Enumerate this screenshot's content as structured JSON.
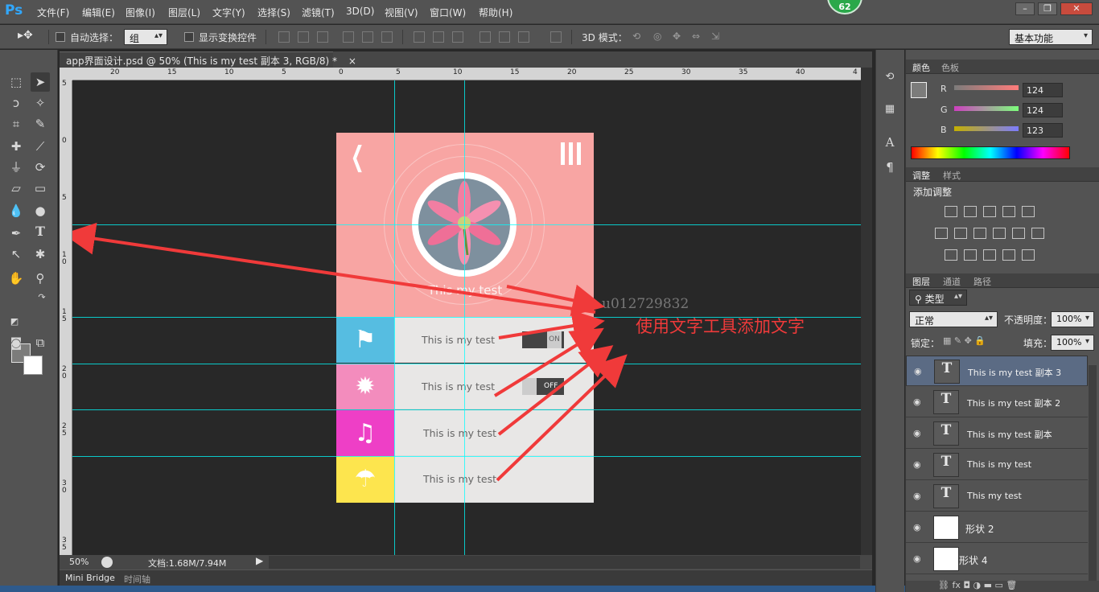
{
  "app": {
    "logo": "Ps",
    "badge": "62"
  },
  "menu": [
    "文件(F)",
    "编辑(E)",
    "图像(I)",
    "图层(L)",
    "文字(Y)",
    "选择(S)",
    "滤镜(T)",
    "3D(D)",
    "视图(V)",
    "窗口(W)",
    "帮助(H)"
  ],
  "options": {
    "auto_select_label": "自动选择：",
    "auto_select_value": "组",
    "show_transform_label": "显示变换控件",
    "mode3d_label": "3D 模式：",
    "workspace": "基本功能"
  },
  "document": {
    "tab_title": "app界面设计.psd @ 50% (This is my test 副本 3, RGB/8) *",
    "close": "×"
  },
  "ruler": {
    "h_ticks": [
      "20",
      "15",
      "10",
      "5",
      "0",
      "5",
      "10",
      "15",
      "20",
      "25",
      "30",
      "35",
      "40",
      "4"
    ],
    "v_ticks": [
      "5",
      "0",
      "5",
      "1\n0",
      "1\n5",
      "2\n0",
      "2\n5",
      "3\n0",
      "3\n5"
    ]
  },
  "mockup": {
    "back_icon": "chevron-left-icon",
    "menu_icon": "hamburger-icon",
    "header_title": "This my test",
    "header_color": "#f8a5a3",
    "rows": [
      {
        "icon": "flag-icon",
        "color": "#56bde1",
        "text": "This is my test",
        "toggle": "ON"
      },
      {
        "icon": "sun-icon",
        "color": "#f38cbd",
        "text": "This is my test",
        "toggle": "OFF"
      },
      {
        "icon": "music-icon",
        "color": "#ee3fc6",
        "text": "This is my test",
        "toggle": ""
      },
      {
        "icon": "umbrella-icon",
        "color": "#fde54e",
        "text": "This is my test",
        "toggle": ""
      }
    ]
  },
  "annotations": {
    "watermark": "u012729832",
    "note": "使用文字工具添加文字",
    "arrow_color": "#f03a3a"
  },
  "status": {
    "zoom": "50%",
    "doc_size": "文档:1.68M/7.94M"
  },
  "bottom_tabs": [
    "Mini Bridge",
    "时间轴"
  ],
  "color_panel": {
    "tabs": [
      "颜色",
      "色板"
    ],
    "channels": [
      {
        "label": "R",
        "value": "124"
      },
      {
        "label": "G",
        "value": "124"
      },
      {
        "label": "B",
        "value": "123"
      }
    ],
    "foreground": "#7c7c7b"
  },
  "adjust_panel": {
    "tabs": [
      "调整",
      "样式"
    ],
    "title": "添加调整"
  },
  "layers_panel": {
    "tabs": [
      "图层",
      "通道",
      "路径"
    ],
    "filter": "类型",
    "blend_mode": "正常",
    "opacity_label": "不透明度：",
    "opacity": "100%",
    "lock_label": "锁定：",
    "fill_label": "填充：",
    "fill": "100%",
    "layers": [
      {
        "name": "This is my test 副本 3",
        "kind": "text",
        "selected": true
      },
      {
        "name": "This is my test 副本 2",
        "kind": "text",
        "selected": false
      },
      {
        "name": "This is my test 副本",
        "kind": "text",
        "selected": false
      },
      {
        "name": "This is my test",
        "kind": "text",
        "selected": false
      },
      {
        "name": "This my test",
        "kind": "text",
        "selected": false
      },
      {
        "name": "形状 2",
        "kind": "shape",
        "selected": false
      },
      {
        "name": "形状 4",
        "kind": "shape",
        "selected": false
      }
    ]
  }
}
